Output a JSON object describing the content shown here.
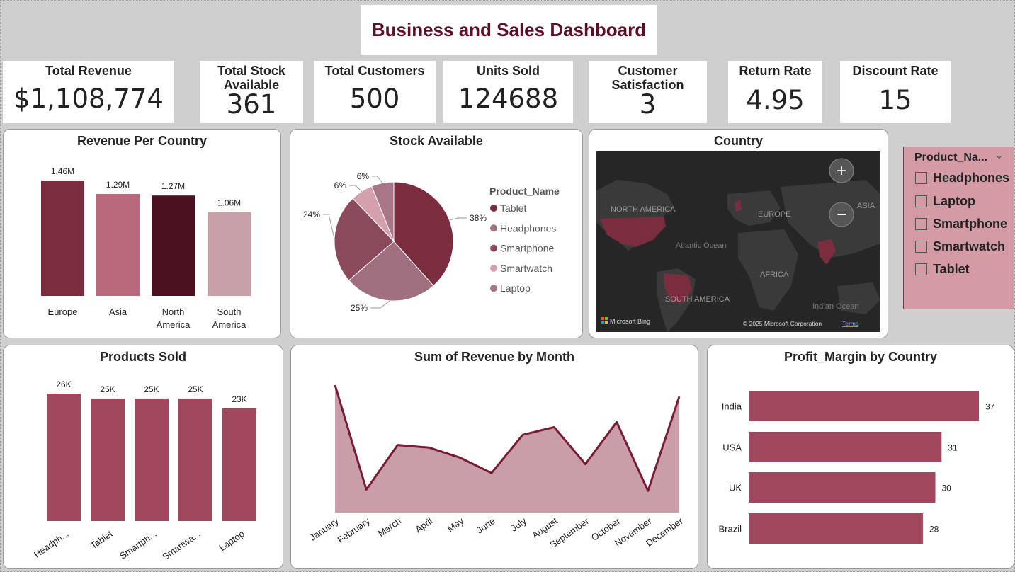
{
  "title": "Business and Sales Dashboard",
  "kpis": [
    {
      "label": "Total Revenue",
      "value": "$1,108,774"
    },
    {
      "label": "Total Stock Available",
      "value": "361"
    },
    {
      "label": "Total Customers",
      "value": "500"
    },
    {
      "label": "Units Sold",
      "value": "124688"
    },
    {
      "label": "Customer Satisfaction",
      "value": "3"
    },
    {
      "label": "Return Rate",
      "value": "4.95"
    },
    {
      "label": "Discount Rate",
      "value": "15"
    }
  ],
  "map": {
    "title": "Country",
    "labels": [
      "NORTH AMERICA",
      "EUROPE",
      "ASIA",
      "Atlantic Ocean",
      "AFRICA",
      "SOUTH AMERICA",
      "Indian Ocean"
    ],
    "attribution": "Microsoft Bing",
    "copyright": "© 2025 Microsoft Corporation",
    "terms": "Terms",
    "zoom_in": "+",
    "zoom_out": "−"
  },
  "slicer": {
    "header": "Product_Na...",
    "chevron": "⌄",
    "items": [
      "Headphones",
      "Laptop",
      "Smartphone",
      "Smartwatch",
      "Tablet"
    ]
  },
  "colors": {
    "dark_maroon": "#4a101f",
    "maroon": "#7a2d3f",
    "rose": "#b8687a",
    "light_rose": "#c8a0a8",
    "bar": "#a0485d",
    "area_fill": "#c99ea8",
    "line": "#7a1c33"
  },
  "chart_data": [
    {
      "type": "bar",
      "title": "Revenue Per Country",
      "categories": [
        "Europe",
        "Asia",
        "North America",
        "South America"
      ],
      "category_lines": [
        [
          "Europe"
        ],
        [
          "Asia"
        ],
        [
          "North",
          "America"
        ],
        [
          "South",
          "America"
        ]
      ],
      "values": [
        1.46,
        1.29,
        1.27,
        1.06
      ],
      "data_labels": [
        "1.46M",
        "1.29M",
        "1.27M",
        "1.06M"
      ],
      "bar_colors": [
        "#7a2d3f",
        "#b8687a",
        "#4a101f",
        "#c8a0a8"
      ],
      "ylim": [
        0,
        1.46
      ]
    },
    {
      "type": "pie",
      "title": "Stock Available",
      "legend_title": "Product_Name",
      "labels": [
        "Tablet",
        "Headphones",
        "Smartphone",
        "Smartwatch",
        "Laptop"
      ],
      "slices": [
        {
          "label": "Tablet",
          "value": 38,
          "display": "38%",
          "color": "#7a2d3f"
        },
        {
          "label": "Headphones",
          "value": 25,
          "display": "25%",
          "color": "#a07080"
        },
        {
          "label": "Smartphone",
          "value": 24,
          "display": "24%",
          "color": "#8a4a5c"
        },
        {
          "label": "Smartwatch",
          "value": 6,
          "display": "6%",
          "color": "#d4a0ae"
        },
        {
          "label": "Laptop",
          "value": 6,
          "display": "6%",
          "color": "#a87686"
        }
      ],
      "legend_colors": [
        "#7a2d3f",
        "#a07080",
        "#8a4a5c",
        "#d4a0ae",
        "#a87686"
      ]
    },
    {
      "type": "bar",
      "title": "Products Sold",
      "categories": [
        "Headph...",
        "Tablet",
        "Smartph...",
        "Smartwa...",
        "Laptop"
      ],
      "values": [
        26,
        25,
        25,
        25,
        23
      ],
      "data_labels": [
        "26K",
        "25K",
        "25K",
        "25K",
        "23K"
      ],
      "ylim": [
        0,
        26
      ]
    },
    {
      "type": "area",
      "title": "Sum of Revenue by Month",
      "categories": [
        "January",
        "February",
        "March",
        "April",
        "May",
        "June",
        "July",
        "August",
        "September",
        "October",
        "November",
        "December"
      ],
      "values": [
        100,
        18,
        53,
        51,
        43,
        31,
        61,
        67,
        38,
        71,
        17,
        91
      ],
      "ylim": [
        0,
        100
      ]
    },
    {
      "type": "bar",
      "orientation": "horizontal",
      "title": "Profit_Margin by Country",
      "categories": [
        "India",
        "USA",
        "UK",
        "Brazil"
      ],
      "values": [
        37,
        31,
        30,
        28
      ],
      "data_labels": [
        "37",
        "31",
        "30",
        "28"
      ],
      "xlim": [
        0,
        37
      ]
    }
  ]
}
